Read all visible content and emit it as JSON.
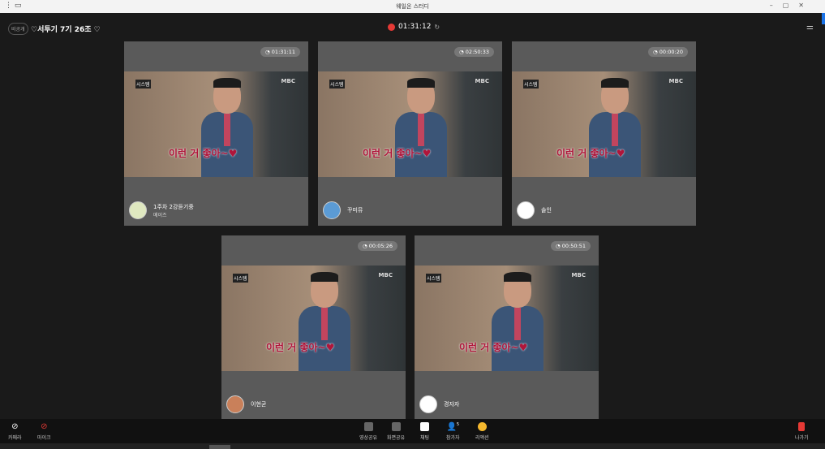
{
  "window": {
    "title": "웨일온 스터디"
  },
  "header": {
    "visibility_badge": "비공개",
    "room_title": "♡서투기 7기 26조 ♡",
    "recording_time": "01:31:12"
  },
  "tiles": [
    {
      "timer": "01:31:11",
      "name": "1주차 2강듣기중",
      "sub": "메이즈",
      "caption": "이런 거 좋아~♥",
      "avatar_color": "#dfe8c0"
    },
    {
      "timer": "02:50:33",
      "name": "꾸미뮤",
      "caption": "이런 거 좋아~♥",
      "avatar_color": "#5b9bd5"
    },
    {
      "timer": "00:00:20",
      "name": "솔인",
      "caption": "이런 거 좋아~♥",
      "avatar_color": "#ffffff"
    },
    {
      "timer": "00:05:26",
      "name": "이현균",
      "caption": "이런 거 좋아~♥",
      "avatar_color": "#c9805a"
    },
    {
      "timer": "00:50:51",
      "name": "경자자",
      "caption": "이런 거 좋아~♥",
      "avatar_color": "#ffffff"
    }
  ],
  "video": {
    "channel_logo": "MBC",
    "show_logo": "시스템"
  },
  "toolbar": {
    "camera": "카메라",
    "mic": "마이크",
    "video_share": "영상공유",
    "screen_share": "화면공유",
    "chat": "채팅",
    "participants": "참가자",
    "participant_count": "5",
    "reaction": "리액션",
    "leave": "나가기"
  }
}
